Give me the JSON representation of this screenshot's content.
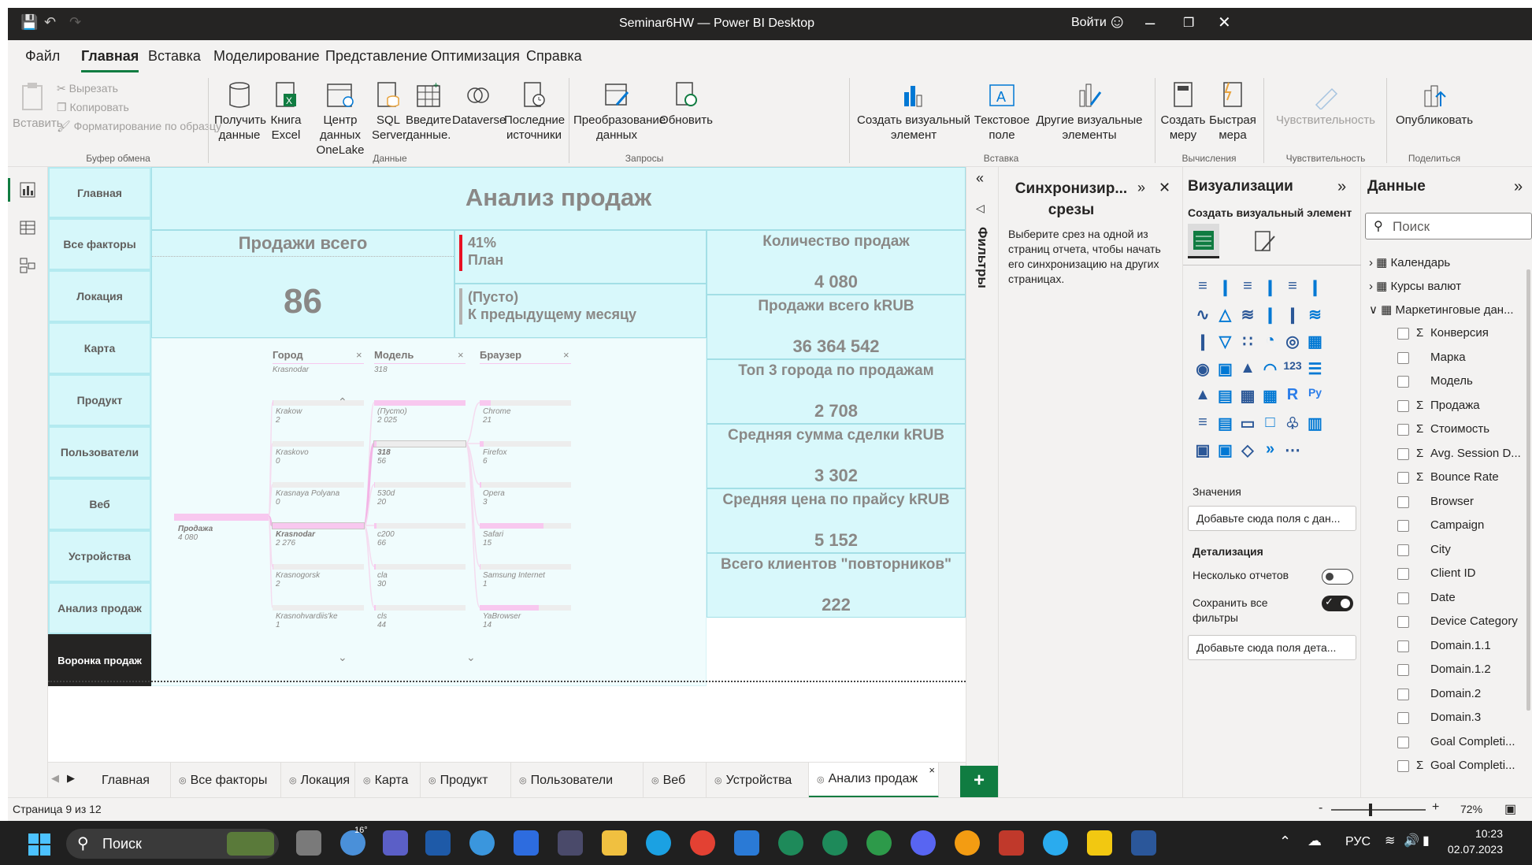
{
  "window": {
    "title": "Seminar6HW — Power BI Desktop",
    "signin": "Войти"
  },
  "menu": [
    "Файл",
    "Главная",
    "Вставка",
    "Моделирование",
    "Представление",
    "Оптимизация",
    "Справка"
  ],
  "ribbon": {
    "clipboard": {
      "paste": "Вставить",
      "cut": "Вырезать",
      "copy": "Копировать",
      "format": "Форматирование по образцу",
      "group": "Буфер обмена"
    },
    "data": {
      "get": "Получить данные",
      "excel": "Книга Excel",
      "onelake": "Центр данных OneLake",
      "sql": "SQL Server",
      "enter": "Введите данные.",
      "dataverse": "Dataverse",
      "recent": "Последние источники",
      "group": "Данные"
    },
    "queries": {
      "transform": "Преобразование данных",
      "refresh": "Обновить",
      "group": "Запросы"
    },
    "insert": {
      "newvisual": "Создать визуальный элемент",
      "textbox": "Текстовое поле",
      "morevisuals": "Другие визуальные элементы",
      "group": "Вставка"
    },
    "calc": {
      "newmeasure": "Создать меру",
      "quickmeasure": "Быстрая мера",
      "group": "Вычисления"
    },
    "sens": {
      "label": "Чувствительность",
      "group": "Чувствительность"
    },
    "share": {
      "publish": "Опубликовать",
      "group": "Поделиться"
    }
  },
  "nav": [
    "Главная",
    "Все факторы",
    "Локация",
    "Карта",
    "Продукт",
    "Пользователи",
    "Веб",
    "Устройства",
    "Анализ продаж",
    "Воронка продаж"
  ],
  "report": {
    "title": "Анализ продаж",
    "sales_total_label": "Продажи всего",
    "sales_total_value": "86",
    "plan_pct": "41%",
    "plan_label": "План",
    "prev_value": "(Пусто)",
    "prev_label": "К предыдущему месяцу",
    "kpis": [
      {
        "label": "Количество продаж",
        "value": "4 080"
      },
      {
        "label": "Продажи всего kRUB",
        "value": "36 364 542"
      },
      {
        "label": "Топ 3 города по продажам",
        "value": "2 708"
      },
      {
        "label": "Средняя сумма сделки kRUB",
        "value": "3 302"
      },
      {
        "label": "Средняя цена по прайсу kRUB",
        "value": "5 152"
      },
      {
        "label": "Всего клиентов \"повторников\"",
        "value": "222"
      }
    ]
  },
  "decomp": {
    "root": {
      "label": "Продажа",
      "value": "4 080"
    },
    "levels": [
      {
        "name": "Город",
        "selected": "Krasnodar",
        "nodes": [
          {
            "label": "Krakow",
            "value": "2",
            "fill": 0.01
          },
          {
            "label": "Kraskovo",
            "value": "0",
            "fill": 0.0
          },
          {
            "label": "Krasnaya Polyana",
            "value": "0",
            "fill": 0.0
          },
          {
            "label": "Krasnodar",
            "value": "2 276",
            "fill": 1.0
          },
          {
            "label": "Krasnogorsk",
            "value": "2",
            "fill": 0.01
          },
          {
            "label": "Krasnohvardiis'ke",
            "value": "1",
            "fill": 0.0
          }
        ]
      },
      {
        "name": "Модель",
        "selected": "318",
        "nodes": [
          {
            "label": "(Пусто)",
            "value": "2 025",
            "fill": 1.0
          },
          {
            "label": "318",
            "value": "56",
            "fill": 0.03
          },
          {
            "label": "530d",
            "value": "20",
            "fill": 0.01
          },
          {
            "label": "c200",
            "value": "66",
            "fill": 0.03
          },
          {
            "label": "cla",
            "value": "30",
            "fill": 0.015
          },
          {
            "label": "cls",
            "value": "44",
            "fill": 0.02
          }
        ]
      },
      {
        "name": "Браузер",
        "selected": "",
        "nodes": [
          {
            "label": "Chrome",
            "value": "21",
            "fill": 0.12
          },
          {
            "label": "Firefox",
            "value": "6",
            "fill": 0.04
          },
          {
            "label": "Opera",
            "value": "3",
            "fill": 0.02
          },
          {
            "label": "Safari",
            "value": "15",
            "fill": 0.7
          },
          {
            "label": "Samsung Internet",
            "value": "1",
            "fill": 0.01
          },
          {
            "label": "YaBrowser",
            "value": "14",
            "fill": 0.65
          }
        ]
      }
    ]
  },
  "filters_label": "Фильтры",
  "sync": {
    "title": "Синхронизир... срезы",
    "text": "Выберите срез на одной из страниц отчета, чтобы начать его синхронизацию на других страницах."
  },
  "viz": {
    "title": "Визуализации",
    "build": "Создать визуальный элемент",
    "values": "Значения",
    "values_ph": "Добавьте сюда поля с дан...",
    "drill": "Детализация",
    "cross": "Несколько отчетов",
    "keep": "Сохранить все фильтры",
    "drill_ph": "Добавьте сюда поля дета..."
  },
  "data": {
    "title": "Данные",
    "search": "Поиск",
    "tables": [
      "Календарь",
      "Курсы валют",
      "Маркетинговые дан..."
    ],
    "fields": [
      {
        "name": "Конверсия",
        "sigma": true
      },
      {
        "name": "Марка",
        "sigma": false
      },
      {
        "name": "Модель",
        "sigma": false
      },
      {
        "name": "Продажа",
        "sigma": true
      },
      {
        "name": "Стоимость",
        "sigma": true
      },
      {
        "name": "Avg. Session D...",
        "sigma": true
      },
      {
        "name": "Bounce Rate",
        "sigma": true
      },
      {
        "name": "Browser",
        "sigma": false
      },
      {
        "name": "Campaign",
        "sigma": false
      },
      {
        "name": "City",
        "sigma": false
      },
      {
        "name": "Client ID",
        "sigma": false
      },
      {
        "name": "Date",
        "sigma": false
      },
      {
        "name": "Device Category",
        "sigma": false
      },
      {
        "name": "Domain.1.1",
        "sigma": false
      },
      {
        "name": "Domain.1.2",
        "sigma": false
      },
      {
        "name": "Domain.2",
        "sigma": false
      },
      {
        "name": "Domain.3",
        "sigma": false
      },
      {
        "name": "Goal Completi...",
        "sigma": false
      },
      {
        "name": "Goal Completi...",
        "sigma": true
      }
    ]
  },
  "tabs": [
    "Главная",
    "Все факторы",
    "Локация",
    "Карта",
    "Продукт",
    "Пользователи",
    "Веб",
    "Устройства",
    "Анализ продаж"
  ],
  "status": {
    "page": "Страница 9 из 12",
    "zoom": "72%"
  },
  "taskbar": {
    "search": "Поиск",
    "lang": "РУС",
    "time": "10:23",
    "date": "02.07.2023",
    "temp": "16°"
  }
}
